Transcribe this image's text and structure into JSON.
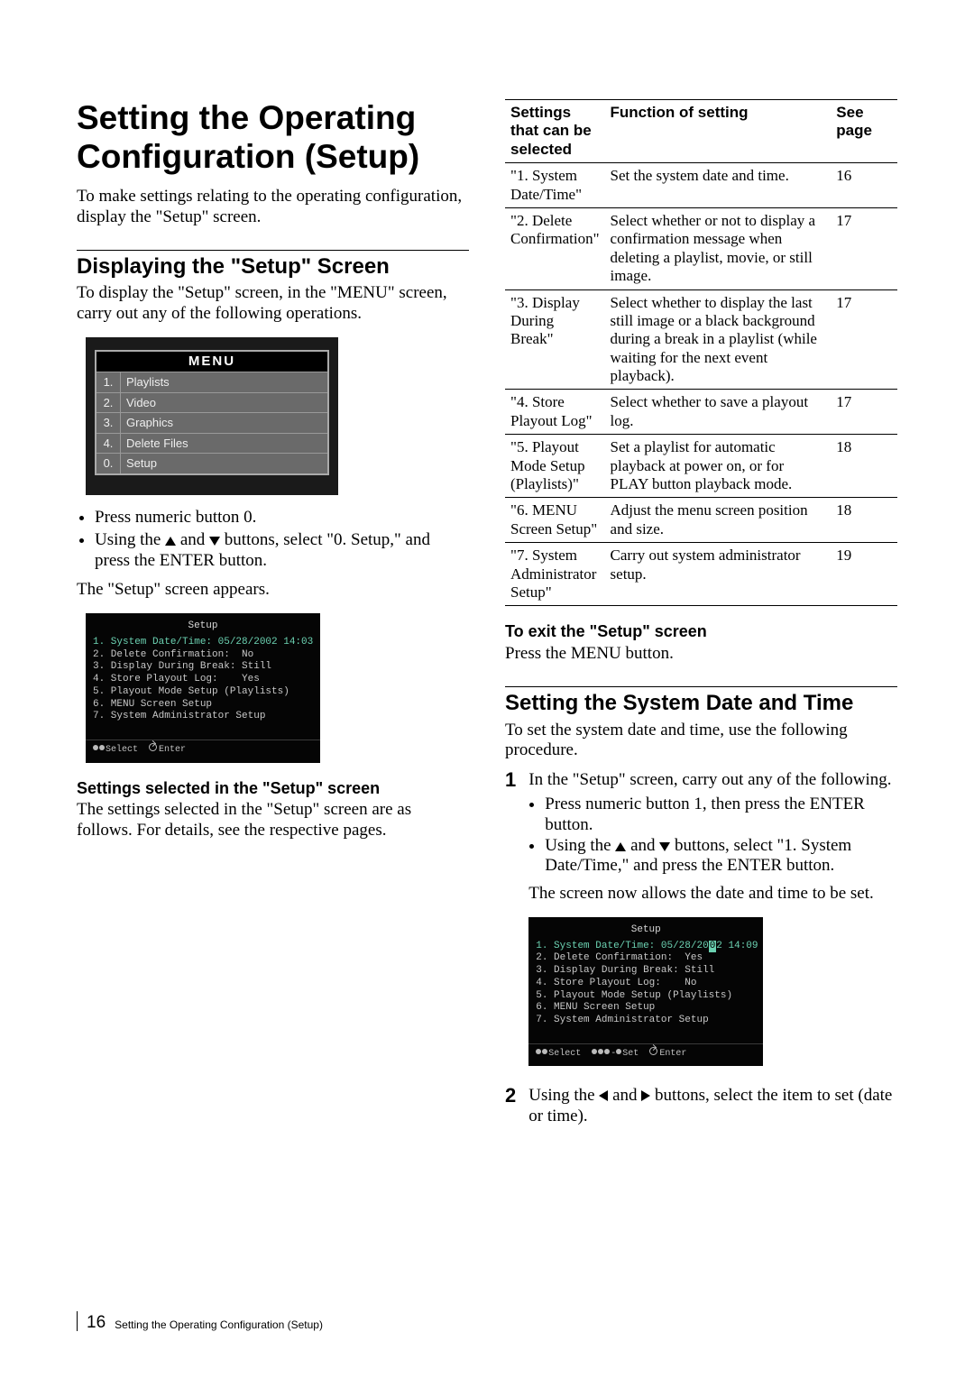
{
  "title": "Setting the Operating Configuration (Setup)",
  "intro": "To make settings relating to the operating configuration, display the \"Setup\" screen.",
  "sec_display": {
    "heading": "Displaying the \"Setup\" Screen",
    "lead": "To display the \"Setup\" screen, in the \"MENU\" screen, carry out any of the following operations.",
    "menu_title": "MENU",
    "menu_items": [
      {
        "n": "1.",
        "t": "Playlists"
      },
      {
        "n": "2.",
        "t": "Video"
      },
      {
        "n": "3.",
        "t": "Graphics"
      },
      {
        "n": "4.",
        "t": "Delete Files"
      },
      {
        "n": "0.",
        "t": "Setup"
      }
    ],
    "bullet1": "Press numeric button 0.",
    "bullet2_a": "Using the ",
    "bullet2_b": " and ",
    "bullet2_c": " buttons, select \"0. Setup,\" and press the ENTER button.",
    "after": "The \"Setup\" screen appears.",
    "setup_title": "Setup",
    "setup_lines": [
      "1. System Date/Time: 05/28/2002 14:03",
      "2. Delete Confirmation:  No",
      "3. Display During Break: Still",
      "4. Store Playout Log:    Yes",
      "5. Playout Mode Setup (Playlists)",
      "6. MENU Screen Setup",
      "7. System Administrator Setup"
    ],
    "setup_footer_select": "Select",
    "setup_footer_enter": "Enter",
    "sub": "Settings selected in the \"Setup\" screen",
    "sub_body": "The settings selected in the \"Setup\" screen are as follows. For details, see the respective pages."
  },
  "table": {
    "h1": "Settings that can be selected",
    "h2": "Function of setting",
    "h3": "See page",
    "rows": [
      {
        "a": "\"1. System Date/Time\"",
        "b": "Set the system date and time.",
        "c": "16"
      },
      {
        "a": "\"2. Delete Confirmation\"",
        "b": "Select whether or not to display a confirmation message when deleting a playlist, movie, or still image.",
        "c": "17"
      },
      {
        "a": "\"3. Display During Break\"",
        "b": "Select whether to display the last still image or a black background during a break in a playlist (while waiting for the next event playback).",
        "c": "17"
      },
      {
        "a": "\"4. Store Playout Log\"",
        "b": "Select whether to save a playout log.",
        "c": "17"
      },
      {
        "a": "\"5. Playout Mode Setup (Playlists)\"",
        "b": "Set a playlist for automatic playback at power on, or for PLAY button playback mode.",
        "c": "18"
      },
      {
        "a": "\"6. MENU Screen Setup\"",
        "b": "Adjust the menu screen position and size.",
        "c": "18"
      },
      {
        "a": "\"7. System Administrator Setup\"",
        "b": "Carry out system administrator setup.",
        "c": "19"
      }
    ]
  },
  "exit": {
    "heading": "To exit the \"Setup\" screen",
    "body": "Press the MENU button."
  },
  "datetime": {
    "heading": "Setting the System Date and Time",
    "lead": "To set the system date and time, use the following procedure.",
    "step1_a": "In the \"Setup\" screen, carry out any of the following.",
    "step1_b1": "Press numeric button 1, then press the ENTER button.",
    "step1_b2_a": "Using the ",
    "step1_b2_b": " and ",
    "step1_b2_c": " buttons, select \"1. System Date/Time,\" and press the ENTER button.",
    "step1_after": "The screen now allows the date and time to be set.",
    "setup_title": "Setup",
    "setup_lines_pre": "1. System Date/Time: 05/28/20",
    "setup_lines_cursor": "0",
    "setup_lines_post": "2 14:09",
    "setup_lines_rest": [
      "2. Delete Confirmation:  Yes",
      "3. Display During Break: Still",
      "4. Store Playout Log:    No",
      "5. Playout Mode Setup (Playlists)",
      "6. MENU Screen Setup",
      "7. System Administrator Setup"
    ],
    "setup_footer_select": "Select",
    "setup_footer_set": "Set",
    "setup_footer_enter": "Enter",
    "step2_a": "Using the ",
    "step2_b": " and ",
    "step2_c": " buttons, select the item to set (date or time)."
  },
  "footer": {
    "page": "16",
    "chapter": "Setting the Operating Configuration (Setup)"
  }
}
